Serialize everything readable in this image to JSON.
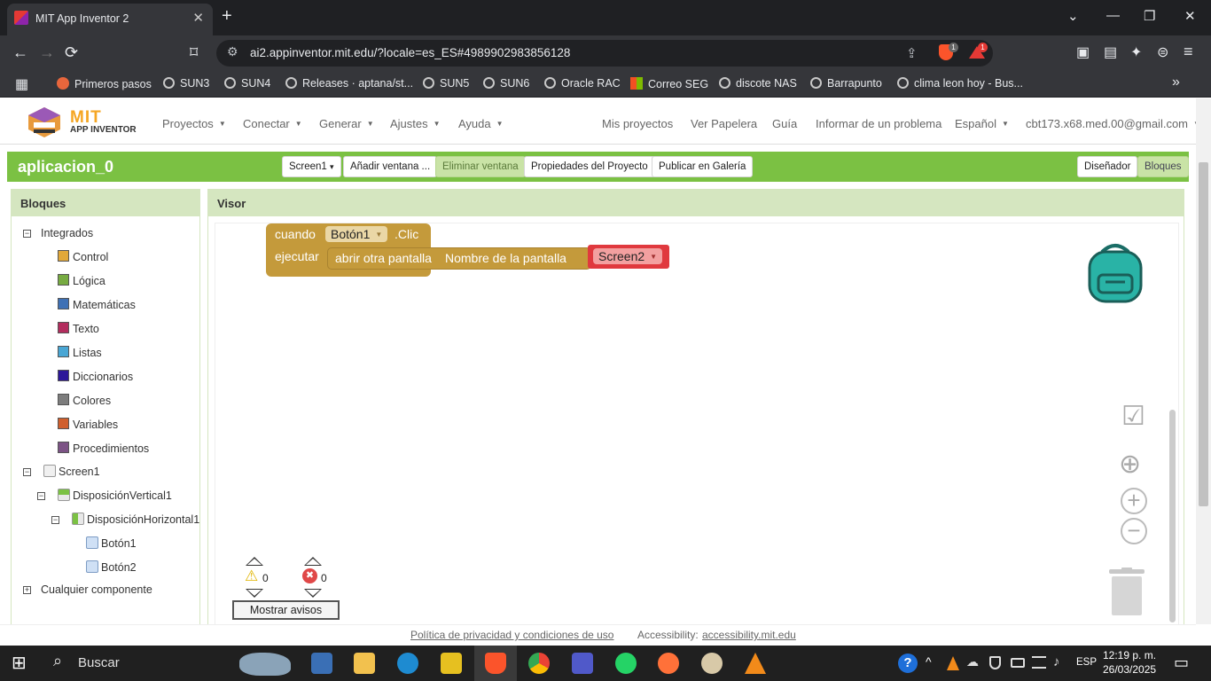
{
  "browser": {
    "tab_title": "MIT App Inventor 2",
    "tab_close": "✕",
    "new_tab": "+",
    "url": "ai2.appinventor.mit.edu/?locale=es_ES#4989902983856128",
    "brave_count": "1",
    "rewards_count": "1",
    "bookmarks": [
      "Primeros pasos",
      "SUN3",
      "SUN4",
      "Releases · aptana/st...",
      "SUN5",
      "SUN6",
      "Oracle RAC",
      "Correo SEG",
      "discote NAS",
      "Barrapunto",
      "clima leon hoy - Bus..."
    ],
    "icons": {
      "minimize": "—",
      "restore": "❐",
      "close": "✕",
      "dropdown": "⌄",
      "back": "←",
      "forward": "→",
      "reload": "⟳",
      "bookmark": "⌑",
      "tune": "⚙",
      "share": "⇪",
      "sidebar": "▣",
      "wallet": "▤",
      "leo": "✦",
      "vpn": "⊜",
      "menu": "≡",
      "apps": "▦",
      "more_bookmarks": "»"
    }
  },
  "app": {
    "logo_title": "MIT",
    "logo_subtitle": "APP INVENTOR",
    "menu_left": [
      "Proyectos",
      "Conectar",
      "Generar",
      "Ajustes",
      "Ayuda"
    ],
    "menu_right": {
      "my_projects": "Mis proyectos",
      "trash": "Ver Papelera",
      "guide": "Guía",
      "report": "Informar de un problema",
      "language": "Español",
      "account": "cbt173.x68.med.00@gmail.com"
    },
    "caret": "▼"
  },
  "project": {
    "name": "aplicacion_0",
    "screen_select": "Screen1",
    "caret": "▾",
    "add_screen": "Añadir ventana ...",
    "remove_screen": "Eliminar ventana",
    "project_props": "Propiedades del Proyecto",
    "publish": "Publicar en Galería",
    "designer": "Diseñador",
    "blocks": "Bloques"
  },
  "blocks_panel": {
    "title": "Bloques",
    "builtin_label": "Integrados",
    "builtins": [
      {
        "label": "Control",
        "color": "#e1a83a"
      },
      {
        "label": "Lógica",
        "color": "#77ab41"
      },
      {
        "label": "Matemáticas",
        "color": "#3f71b5"
      },
      {
        "label": "Texto",
        "color": "#b32d5e"
      },
      {
        "label": "Listas",
        "color": "#49a6d4"
      },
      {
        "label": "Diccionarios",
        "color": "#2d1799"
      },
      {
        "label": "Colores",
        "color": "#7d7d7d"
      },
      {
        "label": "Variables",
        "color": "#d05f2d"
      },
      {
        "label": "Procedimientos",
        "color": "#7c5385"
      }
    ],
    "components": {
      "screen": "Screen1",
      "vertical": "DisposiciónVertical1",
      "horizontal": "DisposiciónHorizontal1",
      "button1": "Botón1",
      "button2": "Botón2"
    },
    "any_component": "Cualquier componente",
    "collapse_sign": "−",
    "expand_sign": "+"
  },
  "viewer": {
    "title": "Visor",
    "event_when": "cuando",
    "event_component": "Botón1",
    "event_name": ".Clic",
    "event_do": "ejecutar",
    "open_screen": "abrir otra pantalla",
    "screen_name_label": "Nombre de la pantalla",
    "screen_value": "Screen2",
    "dd_arrow": "▼",
    "warnings_count": "0",
    "errors_count": "0",
    "show_warnings": "Mostrar avisos",
    "warning_glyph": "⚠",
    "error_glyph": "✖",
    "icons": {
      "validate": "☑",
      "center": "⊕",
      "zoom_in": "+",
      "zoom_out": "−"
    }
  },
  "footer": {
    "privacy": "Política de privacidad y condiciones de uso",
    "accessibility_label": "Accessibility:",
    "accessibility_link": "accessibility.mit.edu"
  },
  "taskbar": {
    "search": "Buscar",
    "search_glyph": "⌕",
    "start_glyph": "⊞",
    "language": "ESP",
    "time": "12:19 p. m.",
    "date": "26/03/2025",
    "notifications_glyph": "▭",
    "tray_glyphs": {
      "help": "?",
      "overflow": "^",
      "network": "☁",
      "volume": "♪"
    }
  }
}
